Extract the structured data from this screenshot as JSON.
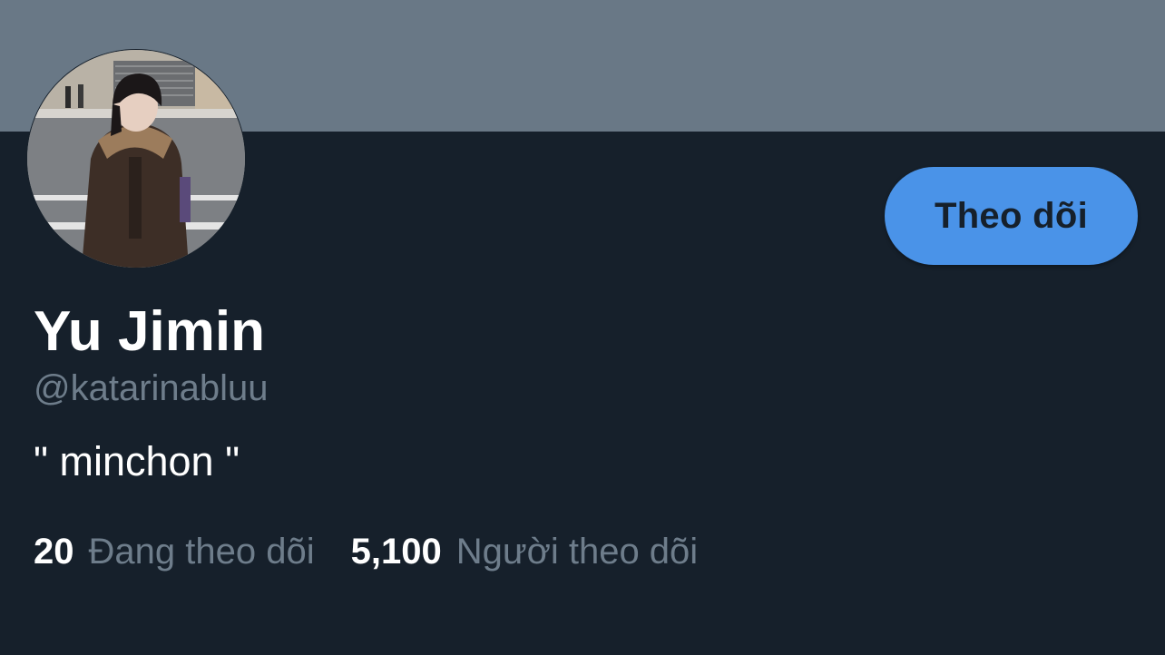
{
  "colors": {
    "banner": "#697886",
    "background": "#16202b",
    "accent": "#4a93e8",
    "muted_text": "#6e7d8b"
  },
  "profile": {
    "display_name": "Yu Jimin",
    "handle": "@katarinabluu",
    "bio": "\" minchon \"",
    "follow_label": "Theo dõi"
  },
  "stats": {
    "following": {
      "count": "20",
      "label": "Đang theo dõi"
    },
    "followers": {
      "count": "5,100",
      "label": "Người theo dõi"
    }
  }
}
